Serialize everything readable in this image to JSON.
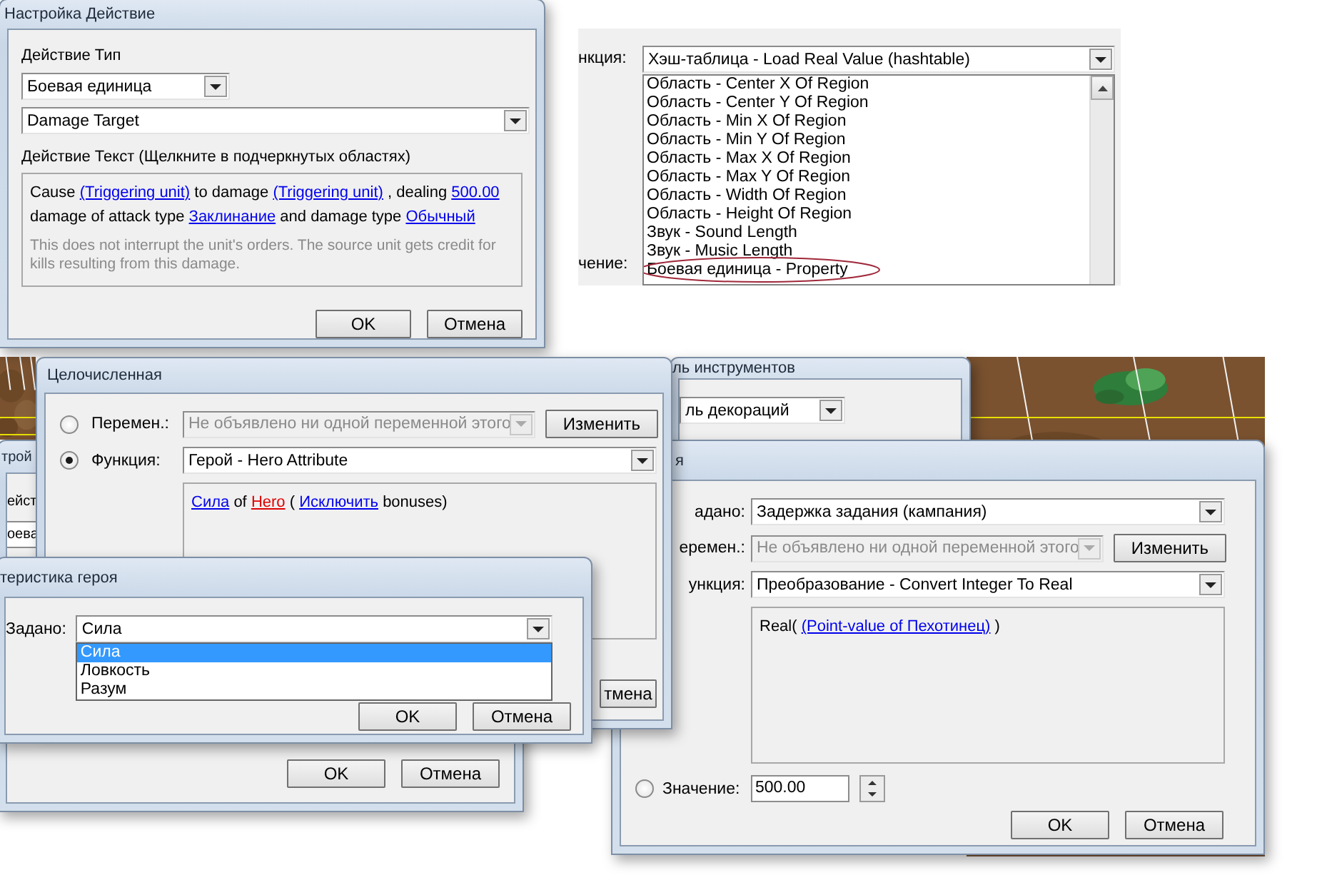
{
  "action_dialog": {
    "title": "Настройка Действие",
    "type_label": "Действие Тип",
    "category": "Боевая единица",
    "action": "Damage Target",
    "text_label": "Действие Текст (Щелкните в подчеркнутых областях)",
    "sentence": [
      {
        "kind": "plain",
        "text": "Cause"
      },
      {
        "kind": "link",
        "text": "(Triggering unit)"
      },
      {
        "kind": "plain",
        "text": "to damage"
      },
      {
        "kind": "link",
        "text": "(Triggering unit)"
      },
      {
        "kind": "plain",
        "text": ", dealing"
      },
      {
        "kind": "link",
        "text": "500.00"
      },
      {
        "kind": "plain",
        "text": "damage of attack type"
      },
      {
        "kind": "link",
        "text": "Заклинание"
      },
      {
        "kind": "plain",
        "text": "and damage type"
      },
      {
        "kind": "link",
        "text": "Обычный"
      }
    ],
    "note": "This does not interrupt the unit's orders.  The source unit gets credit for kills resulting from this damage.",
    "buttons": [
      "OK",
      "Отмена"
    ]
  },
  "function_list": {
    "function_label": "нкция:",
    "value_label": "чение:",
    "function": "Хэш-таблица - Load Real Value (hashtable)",
    "items": [
      {
        "text": "Область - Center X Of Region",
        "selected": false,
        "circled": false
      },
      {
        "text": "Область - Center Y Of Region",
        "selected": false,
        "circled": false
      },
      {
        "text": "Область - Min X Of Region",
        "selected": false,
        "circled": false
      },
      {
        "text": "Область - Min Y Of Region",
        "selected": false,
        "circled": false
      },
      {
        "text": "Область - Max X Of Region",
        "selected": false,
        "circled": false
      },
      {
        "text": "Область - Max Y Of Region",
        "selected": false,
        "circled": false
      },
      {
        "text": "Область - Width Of Region",
        "selected": false,
        "circled": false
      },
      {
        "text": "Область - Height Of Region",
        "selected": false,
        "circled": false
      },
      {
        "text": "Звук - Sound Length",
        "selected": false,
        "circled": false
      },
      {
        "text": "Звук - Music Length",
        "selected": false,
        "circled": false
      },
      {
        "text": "Боевая единица - Property",
        "selected": false,
        "circled": true
      }
    ]
  },
  "back_dialog": {
    "title": "трой",
    "label": "ейст",
    "value": "оева",
    "buttons": [
      "OK",
      "Отмена"
    ]
  },
  "tool_palette": {
    "title": "ль инструментов",
    "value": "ль декораций"
  },
  "integer_dialog": {
    "title": "Целочисленная",
    "rows": [
      {
        "kind": "variable",
        "label": "Перемен.:",
        "selected": false,
        "disabled": true,
        "value": "Не объявлено ни одной переменной этого",
        "button": "Изменить"
      },
      {
        "kind": "function",
        "label": "Функция:",
        "selected": true,
        "value": "Герой - Hero Attribute"
      }
    ],
    "expression": [
      {
        "kind": "link",
        "text": "Сила"
      },
      {
        "kind": "plain",
        "text": "of"
      },
      {
        "kind": "unset",
        "text": "Hero"
      },
      {
        "kind": "plain",
        "text": "("
      },
      {
        "kind": "link",
        "text": "Исключить"
      },
      {
        "kind": "plain",
        "text": "bonuses)"
      }
    ],
    "cancel": "тмена"
  },
  "hero_attribute_dialog": {
    "title": "теристика героя",
    "label": "Задано:",
    "value": "Сила",
    "options": [
      {
        "text": "Сила",
        "selected": true
      },
      {
        "text": "Ловкость",
        "selected": false
      },
      {
        "text": "Разум",
        "selected": false
      }
    ],
    "buttons": [
      "OK",
      "Отмена"
    ]
  },
  "real_dialog": {
    "title": "я",
    "rows": [
      {
        "kind": "preset",
        "label": "адано:",
        "value": "Задержка задания (кампания)"
      },
      {
        "kind": "variable",
        "label": "еремен.:",
        "disabled": true,
        "value": "Не объявлено ни одной переменной этого",
        "button": "Изменить"
      },
      {
        "kind": "function",
        "label": "ункция:",
        "value": "Преобразование - Convert Integer To Real"
      }
    ],
    "expression": [
      {
        "kind": "plain",
        "text": "Real("
      },
      {
        "kind": "link",
        "text": "(Point-value of Пехотинец)"
      },
      {
        "kind": "plain",
        "text": ")"
      }
    ],
    "value_row": {
      "label": "Значение:",
      "selected": false,
      "value": "500.00"
    },
    "buttons": [
      "OK",
      "Отмена"
    ]
  }
}
